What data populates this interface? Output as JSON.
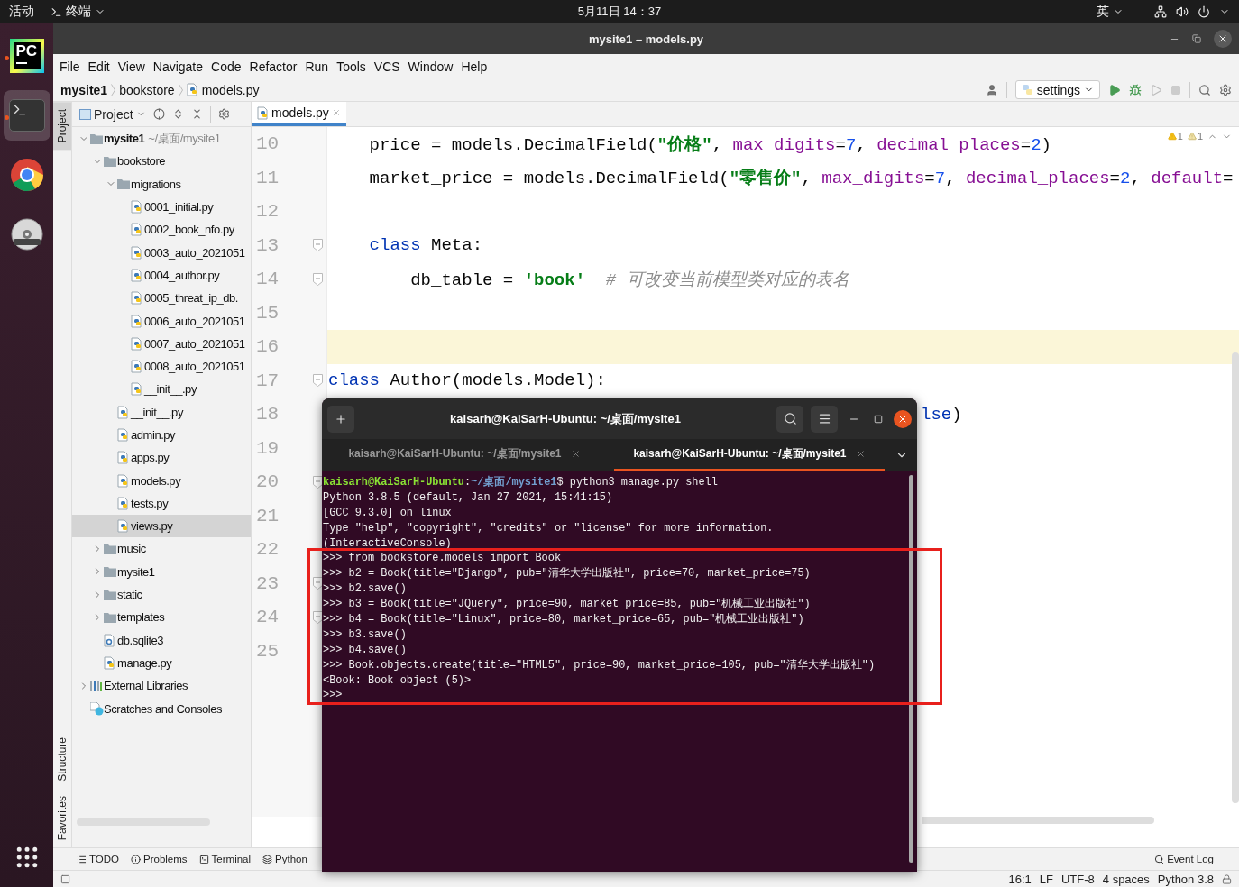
{
  "top_bar": {
    "activities": "活动",
    "app_menu": "终端",
    "clock": "5月11日 14：37",
    "input_method": "英"
  },
  "dock": [
    {
      "kind": "pycharm",
      "label": "PC",
      "running": true,
      "selected": false
    },
    {
      "kind": "terminal",
      "running": true,
      "selected": true
    },
    {
      "kind": "chrome",
      "running": false,
      "selected": false
    },
    {
      "kind": "dvd",
      "running": false,
      "selected": false
    }
  ],
  "window": {
    "title": "mysite1 – models.py"
  },
  "menu": [
    "File",
    "Edit",
    "View",
    "Navigate",
    "Code",
    "Refactor",
    "Run",
    "Tools",
    "VCS",
    "Window",
    "Help"
  ],
  "breadcrumbs": [
    {
      "label": "mysite1",
      "kind": "project"
    },
    {
      "label": "bookstore",
      "kind": "folder"
    },
    {
      "label": "models.py",
      "kind": "pyfile"
    }
  ],
  "run_config": {
    "label": "settings"
  },
  "tool_window": {
    "title": "Project"
  },
  "side_tabs": [
    {
      "label": "Project",
      "kind": "top",
      "selected": true
    },
    {
      "label": "Structure",
      "kind": "bottom",
      "selected": false
    },
    {
      "label": "Favorites",
      "kind": "bottom",
      "selected": false
    }
  ],
  "tree": [
    {
      "label": "mysite1",
      "kind": "project",
      "hint": "~/桌面/mysite1",
      "expanded": true,
      "selected": false,
      "children": [
        {
          "label": "bookstore",
          "kind": "folder",
          "expanded": true,
          "selected": false,
          "children": [
            {
              "label": "migrations",
              "kind": "folder",
              "expanded": true,
              "selected": false,
              "children": [
                {
                  "label": "0001_initial.py",
                  "kind": "pyfile",
                  "selected": false
                },
                {
                  "label": "0002_book_nfo.py",
                  "kind": "pyfile",
                  "selected": false
                },
                {
                  "label": "0003_auto_2021051",
                  "kind": "pyfile",
                  "selected": false
                },
                {
                  "label": "0004_author.py",
                  "kind": "pyfile",
                  "selected": false
                },
                {
                  "label": "0005_threat_ip_db.",
                  "kind": "pyfile",
                  "selected": false
                },
                {
                  "label": "0006_auto_2021051",
                  "kind": "pyfile",
                  "selected": false
                },
                {
                  "label": "0007_auto_2021051",
                  "kind": "pyfile",
                  "selected": false
                },
                {
                  "label": "0008_auto_2021051",
                  "kind": "pyfile",
                  "selected": false
                },
                {
                  "label": "__init__.py",
                  "kind": "pyfile",
                  "selected": false
                }
              ]
            },
            {
              "label": "__init__.py",
              "kind": "pyfile",
              "selected": false
            },
            {
              "label": "admin.py",
              "kind": "pyfile",
              "selected": false
            },
            {
              "label": "apps.py",
              "kind": "pyfile",
              "selected": false
            },
            {
              "label": "models.py",
              "kind": "pyfile",
              "selected": false
            },
            {
              "label": "tests.py",
              "kind": "pyfile",
              "selected": false
            },
            {
              "label": "views.py",
              "kind": "pyfile",
              "selected": true
            }
          ]
        },
        {
          "label": "music",
          "kind": "folder",
          "expanded": false,
          "selected": false
        },
        {
          "label": "mysite1",
          "kind": "folder",
          "expanded": false,
          "selected": false
        },
        {
          "label": "static",
          "kind": "folder",
          "expanded": false,
          "selected": false
        },
        {
          "label": "templates",
          "kind": "folder",
          "expanded": false,
          "selected": false
        },
        {
          "label": "db.sqlite3",
          "kind": "dbfile",
          "selected": false
        },
        {
          "label": "manage.py",
          "kind": "pyfile",
          "selected": false
        }
      ]
    },
    {
      "label": "External Libraries",
      "kind": "libraries",
      "expanded": false,
      "selected": false
    },
    {
      "label": "Scratches and Consoles",
      "kind": "scratches",
      "selected": false
    }
  ],
  "editor": {
    "tabs": [
      {
        "label": "models.py",
        "selected": true
      }
    ],
    "inspections": [
      {
        "count": "1",
        "kind": "warning"
      },
      {
        "count": "1",
        "kind": "weak"
      }
    ],
    "lines": [
      {
        "number": "10",
        "fold": false,
        "current": false,
        "tokens": [
          {
            "text": "    price = models.DecimalField(",
            "kind": "plain"
          },
          {
            "text": "\"价格\"",
            "kind": "string"
          },
          {
            "text": ", ",
            "kind": "plain"
          },
          {
            "text": "max_digits",
            "kind": "param"
          },
          {
            "text": "=",
            "kind": "plain"
          },
          {
            "text": "7",
            "kind": "number"
          },
          {
            "text": ", ",
            "kind": "plain"
          },
          {
            "text": "decimal_places",
            "kind": "param"
          },
          {
            "text": "=",
            "kind": "plain"
          },
          {
            "text": "2",
            "kind": "number"
          },
          {
            "text": ")",
            "kind": "plain"
          }
        ]
      },
      {
        "number": "11",
        "fold": false,
        "current": false,
        "tokens": [
          {
            "text": "    market_price = models.DecimalField(",
            "kind": "plain"
          },
          {
            "text": "\"零售价\"",
            "kind": "string"
          },
          {
            "text": ", ",
            "kind": "plain"
          },
          {
            "text": "max_digits",
            "kind": "param"
          },
          {
            "text": "=",
            "kind": "plain"
          },
          {
            "text": "7",
            "kind": "number"
          },
          {
            "text": ", ",
            "kind": "plain"
          },
          {
            "text": "decimal_places",
            "kind": "param"
          },
          {
            "text": "=",
            "kind": "plain"
          },
          {
            "text": "2",
            "kind": "number"
          },
          {
            "text": ", ",
            "kind": "plain"
          },
          {
            "text": "default",
            "kind": "param"
          },
          {
            "text": "=",
            "kind": "plain"
          }
        ]
      },
      {
        "number": "12",
        "fold": false,
        "current": false
      },
      {
        "number": "13",
        "fold": true,
        "current": false,
        "tokens": [
          {
            "text": "    class",
            "kind": "keyword"
          },
          {
            "text": " Meta:",
            "kind": "plain"
          }
        ]
      },
      {
        "number": "14",
        "fold": true,
        "current": false,
        "tokens": [
          {
            "text": "        db_table = ",
            "kind": "plain"
          },
          {
            "text": "'book'",
            "kind": "string"
          },
          {
            "text": "  # 可改变当前模型类对应的表名",
            "kind": "comment"
          }
        ]
      },
      {
        "number": "15",
        "fold": false,
        "current": false
      },
      {
        "number": "16",
        "fold": false,
        "current": true
      },
      {
        "number": "17",
        "fold": true,
        "current": false,
        "tokens": [
          {
            "text": "class",
            "kind": "keyword"
          },
          {
            "text": " Author(models.Model):",
            "kind": "plain"
          }
        ]
      },
      {
        "number": "18",
        "fold": false,
        "current": false,
        "clipped_start": true,
        "tokens": [
          {
            "text": "lse",
            "kind": "keyword"
          },
          {
            "text": ")",
            "kind": "plain"
          }
        ]
      },
      {
        "number": "19",
        "fold": false,
        "current": false
      },
      {
        "number": "20",
        "fold": true,
        "current": false
      },
      {
        "number": "21",
        "fold": false,
        "current": false
      },
      {
        "number": "22",
        "fold": false,
        "current": false
      },
      {
        "number": "23",
        "fold": true,
        "current": false
      },
      {
        "number": "24",
        "fold": true,
        "current": false
      },
      {
        "number": "25",
        "fold": false,
        "current": false
      }
    ]
  },
  "terminal": {
    "title": "kaisarh@KaiSarH-Ubuntu: ~/桌面/mysite1",
    "tabs": [
      {
        "label": "kaisarh@KaiSarH-Ubuntu: ~/桌面/mysite1",
        "selected": false
      },
      {
        "label": "kaisarh@KaiSarH-Ubuntu: ~/桌面/mysite1",
        "selected": true
      }
    ],
    "lines": [
      {
        "tokens": [
          {
            "text": "kaisarh@KaiSarH-Ubuntu",
            "kind": "user"
          },
          {
            "text": ":",
            "kind": "text"
          },
          {
            "text": "~/桌面/mysite1",
            "kind": "path"
          },
          {
            "text": "$ python3 manage.py shell",
            "kind": "text"
          }
        ]
      },
      {
        "text": "Python 3.8.5 (default, Jan 27 2021, 15:41:15)"
      },
      {
        "text": "[GCC 9.3.0] on linux"
      },
      {
        "text": "Type \"help\", \"copyright\", \"credits\" or \"license\" for more information."
      },
      {
        "text": "(InteractiveConsole)"
      },
      {
        "text": ">>> from bookstore.models import Book"
      },
      {
        "text": ">>> b2 = Book(title=\"Django\", pub=\"清华大学出版社\", price=70, market_price=75)"
      },
      {
        "text": ">>> b2.save()"
      },
      {
        "text": ">>> b3 = Book(title=\"JQuery\", price=90, market_price=85, pub=\"机械工业出版社\")"
      },
      {
        "text": ">>> b4 = Book(title=\"Linux\", price=80, market_price=65, pub=\"机械工业出版社\")"
      },
      {
        "text": ">>> b3.save()"
      },
      {
        "text": ">>> b4.save()"
      },
      {
        "text": ">>> Book.objects.create(title=\"HTML5\", price=90, market_price=105, pub=\"清华大学出版社\")"
      },
      {
        "text": "<Book: Book object (5)>"
      },
      {
        "text": ">>>"
      }
    ]
  },
  "highlight_box": true,
  "bottom_tabs": [
    {
      "label": "TODO",
      "kind": "todo"
    },
    {
      "label": "Problems",
      "kind": "problems"
    },
    {
      "label": "Terminal",
      "kind": "terminal"
    },
    {
      "label": "Python",
      "kind": "python"
    }
  ],
  "event_log": "Event Log",
  "status_bar": [
    "16:1",
    "LF",
    "UTF-8",
    "4 spaces",
    "Python 3.8"
  ]
}
